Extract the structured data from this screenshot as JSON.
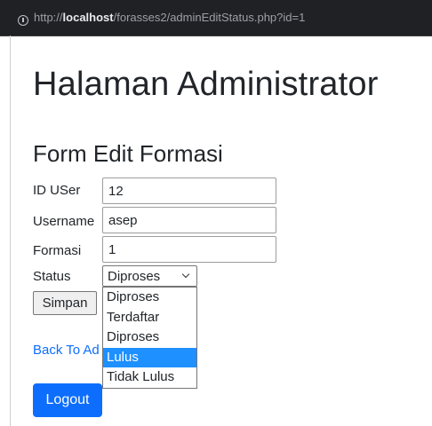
{
  "browser": {
    "url_prefix": "http://",
    "url_host": "localhost",
    "url_path": "/forasses2/adminEditStatus.php?id=1"
  },
  "page": {
    "title": "Halaman Administrator",
    "subtitle": "Form Edit Formasi"
  },
  "form": {
    "id_user": {
      "label": "ID USer",
      "value": "12"
    },
    "username": {
      "label": "Username",
      "value": "asep"
    },
    "formasi": {
      "label": "Formasi",
      "value": "1"
    },
    "status": {
      "label": "Status",
      "selected": "Diproses",
      "options": [
        "Diproses",
        "Terdaftar",
        "Diproses",
        "Lulus",
        "Tidak Lulus"
      ],
      "highlighted": "Lulus"
    },
    "submit_label": "Simpan"
  },
  "back_link": "Back To Ad",
  "logout_label": "Logout",
  "colors": {
    "primary": "#0d6efd",
    "highlight": "#1e90ff",
    "addressbar": "#202124"
  }
}
